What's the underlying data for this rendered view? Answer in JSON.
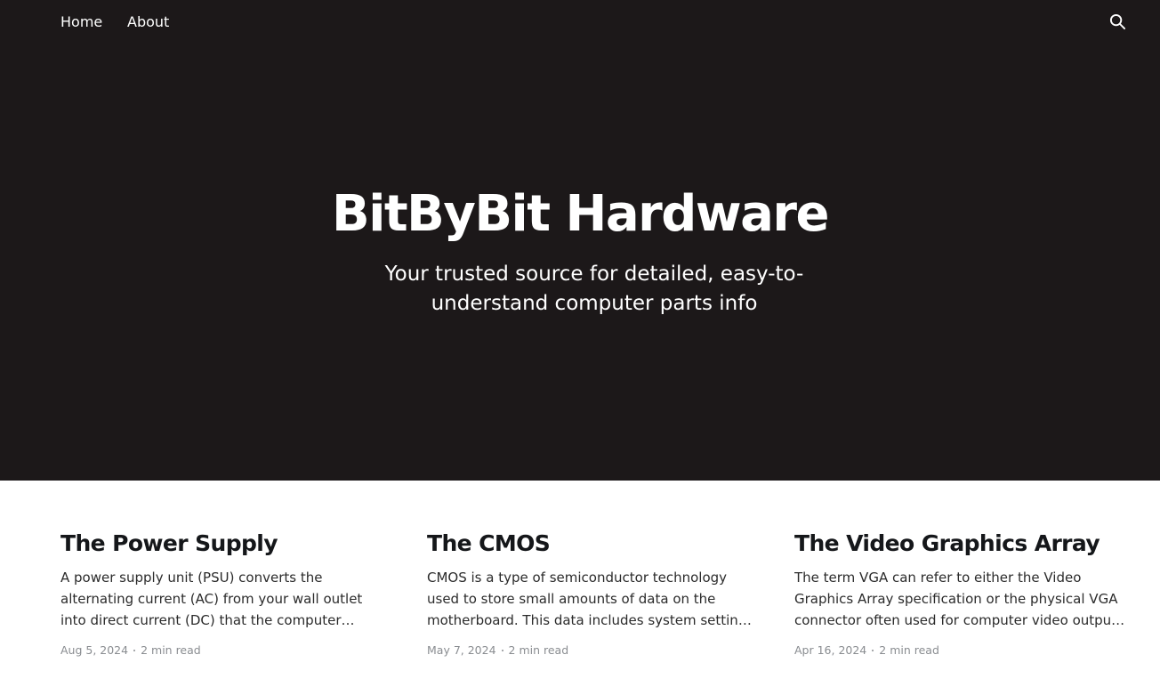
{
  "nav": {
    "items": [
      {
        "label": "Home"
      },
      {
        "label": "About"
      }
    ],
    "search_icon": "search-icon"
  },
  "hero": {
    "title": "BitByBit Hardware",
    "description": "Your trusted source for detailed, easy-to-understand computer parts info"
  },
  "posts": [
    {
      "title": "The Power Supply",
      "excerpt": "A power supply unit (PSU) converts the alternating current (AC) from your wall outlet into direct current (DC) that the computer components require. It…",
      "date": "Aug 5, 2024",
      "read_time": "2 min read"
    },
    {
      "title": "The CMOS",
      "excerpt": "CMOS is a type of semiconductor technology used to store small amounts of data on the motherboard. This data includes system settings and configurati…",
      "date": "May 7, 2024",
      "read_time": "2 min read"
    },
    {
      "title": "The Video Graphics Array",
      "excerpt": "The term VGA can refer to either the Video Graphics Array specification or the physical VGA connector often used for computer video output. Below, I'll…",
      "date": "Apr 16, 2024",
      "read_time": "2 min read"
    }
  ],
  "colors": {
    "hero_background": "#1c1819",
    "text_dark": "#15171a",
    "meta_gray": "#8a8d91"
  }
}
